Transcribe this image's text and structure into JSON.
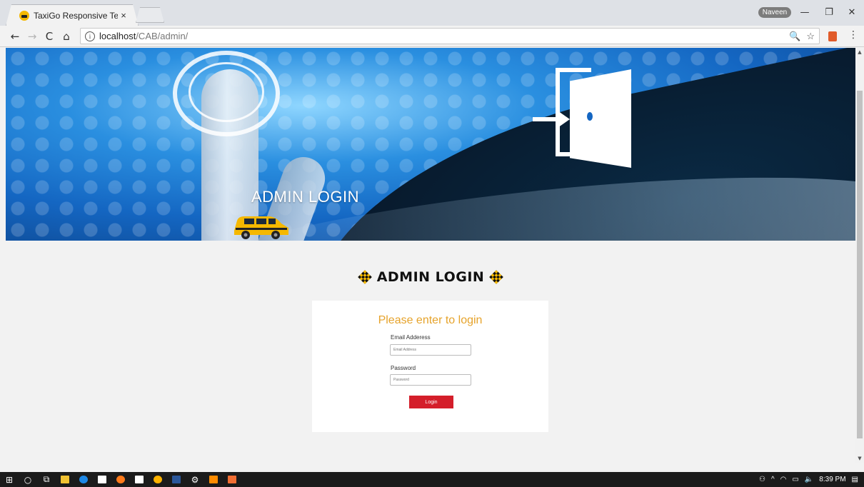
{
  "browser": {
    "tab_title": "TaxiGo Responsive Templ",
    "tab_close": "×",
    "profile_name": "Naveen",
    "window_min": "—",
    "window_max": "❐",
    "window_close": "✕",
    "nav_back": "←",
    "nav_forward": "→",
    "nav_reload": "C",
    "nav_home": "⌂",
    "info_icon": "i",
    "url_host": "localhost",
    "url_path": "/CAB/admin/",
    "zoom_icon": "🔍",
    "star_icon": "☆",
    "menu_icon": "⋮"
  },
  "banner": {
    "title": "ADMIN LOGIN"
  },
  "login": {
    "heading": "ADMIN LOGIN",
    "card_title": "Please enter to login",
    "email_label": "Email Adderess",
    "email_placeholder": "Email Address",
    "password_label": "Password",
    "password_placeholder": "Password",
    "button_label": "Login"
  },
  "taskbar": {
    "time": "8:39 PM",
    "apps": [
      "windows-start",
      "search",
      "task-view",
      "file-explorer",
      "edge",
      "store",
      "firefox",
      "mail",
      "chrome",
      "word",
      "settings",
      "sublime",
      "xampp"
    ],
    "colors": {
      "file-explorer": "#f1c232",
      "edge": "#1e88e5",
      "store": "#ffffff",
      "firefox": "#ff7a1a",
      "mail": "#ffffff",
      "chrome": "#ffb300",
      "word": "#2b579a",
      "settings": "#ffffff",
      "sublime": "#ff8c00",
      "xampp": "#f26e33"
    }
  },
  "colors": {
    "accent_orange": "#e6a32b",
    "button_red": "#d41e2a",
    "taxi_yellow": "#f5b800"
  }
}
